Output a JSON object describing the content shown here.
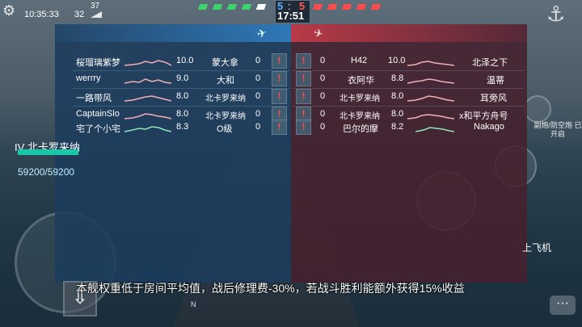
{
  "status": {
    "time": "10:35:33",
    "ping": "32",
    "fps": "37"
  },
  "score": {
    "blue": "5",
    "sep": ":",
    "red": "5",
    "timer": "17:51"
  },
  "colors": {
    "blue_team": "#2f78b8",
    "red_team": "#b83a48",
    "hp_green": "#18c6a8",
    "report_red": "#ff4b4b"
  },
  "blue_team": [
    {
      "name": "桜瑠璃紫梦",
      "rating": "10.0",
      "ship": "蒙大拿",
      "score": "0"
    },
    {
      "name": "werrry",
      "rating": "9.0",
      "ship": "大和",
      "score": "0"
    },
    {
      "name": "一路带风",
      "rating": "8.0",
      "ship": "北卡罗来纳",
      "score": "0"
    },
    {
      "name": "CaptainSlo",
      "rating": "8.0",
      "ship": "北卡罗来纳",
      "score": "0"
    },
    {
      "name": "宅了个小宅",
      "rating": "8.3",
      "ship": "O级",
      "score": "0"
    }
  ],
  "red_team": [
    {
      "score": "0",
      "ship": "H42",
      "rating": "10.0",
      "name": "北泽之下"
    },
    {
      "score": "0",
      "ship": "衣阿华",
      "rating": "8.8",
      "name": "温蒂"
    },
    {
      "score": "0",
      "ship": "北卡罗来纳",
      "rating": "8.0",
      "name": "耳旁风"
    },
    {
      "score": "0",
      "ship": "北卡罗来纳",
      "rating": "8.0",
      "name": "x和平方舟号"
    },
    {
      "score": "0",
      "ship": "巴尔的摩",
      "rating": "8.2",
      "name": "Nakago"
    }
  ],
  "report_label": "!",
  "notice": "本舰权重低于房间平均值，战后修理费-30%，若战斗胜利能额外获得15%收益",
  "hud": {
    "ship_label": "IV 北卡罗来纳",
    "hp_text": "59200/59200",
    "takeoff": "上飞机",
    "right_info": "副炮/防空炮 已开启",
    "compass": "N"
  }
}
